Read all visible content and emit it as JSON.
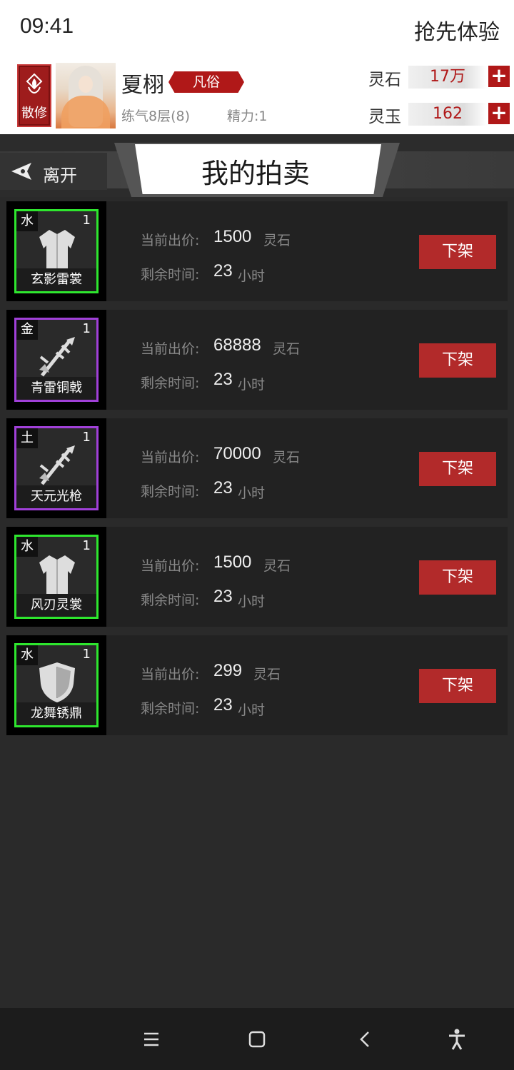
{
  "status": {
    "time": "09:41",
    "early_access": "抢先体验"
  },
  "profile": {
    "badge": "散修",
    "name": "夏栩",
    "rank": "凡俗",
    "level": "练气8层(8)",
    "energy": "精力:1",
    "currencies": [
      {
        "label": "灵石",
        "value": "17万"
      },
      {
        "label": "灵玉",
        "value": "162"
      }
    ]
  },
  "header": {
    "leave": "离开",
    "title": "我的拍卖"
  },
  "labels": {
    "current_bid": "当前出价:",
    "remaining": "剩余时间:",
    "hour_unit": "小时",
    "price_unit": "灵石",
    "delist": "下架"
  },
  "items": [
    {
      "element": "水",
      "qty": "1",
      "name": "玄影雷裳",
      "icon": "robe-icon",
      "rarity": "green",
      "price": "1500",
      "hours": "23"
    },
    {
      "element": "金",
      "qty": "1",
      "name": "青雷铜戟",
      "icon": "halberd-icon",
      "rarity": "purple",
      "price": "68888",
      "hours": "23"
    },
    {
      "element": "土",
      "qty": "1",
      "name": "天元光枪",
      "icon": "spear-icon",
      "rarity": "purple",
      "price": "70000",
      "hours": "23"
    },
    {
      "element": "水",
      "qty": "1",
      "name": "风刃灵裳",
      "icon": "robe-icon",
      "rarity": "green",
      "price": "1500",
      "hours": "23"
    },
    {
      "element": "水",
      "qty": "1",
      "name": "龙舞锈鼎",
      "icon": "shield-icon",
      "rarity": "green",
      "price": "299",
      "hours": "23"
    }
  ],
  "colors": {
    "accent_red": "#b22a2a",
    "rarity_green": "#2ee62e",
    "rarity_purple": "#a040d8"
  }
}
